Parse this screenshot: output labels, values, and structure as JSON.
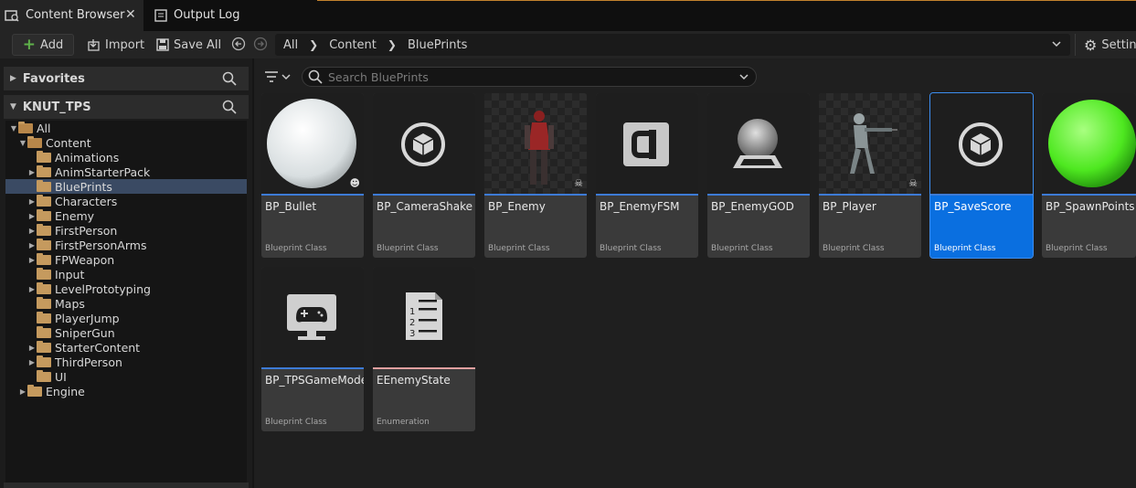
{
  "tabs": [
    {
      "label": "Content Browser",
      "active": true,
      "icon": "content-browser-icon"
    },
    {
      "label": "Output Log",
      "active": false,
      "icon": "output-log-icon"
    }
  ],
  "toolbar": {
    "add_label": "Add",
    "import_label": "Import",
    "save_all_label": "Save All",
    "settings_label": "Settin"
  },
  "breadcrumb": [
    "All",
    "Content",
    "BluePrints"
  ],
  "left": {
    "favorites_label": "Favorites",
    "project_label": "KNUT_TPS",
    "tree": [
      {
        "label": "All",
        "level": 0,
        "caret": "open"
      },
      {
        "label": "Content",
        "level": 1,
        "caret": "open"
      },
      {
        "label": "Animations",
        "level": 2,
        "caret": ""
      },
      {
        "label": "AnimStarterPack",
        "level": 2,
        "caret": "closed"
      },
      {
        "label": "BluePrints",
        "level": 2,
        "caret": "",
        "selected": true
      },
      {
        "label": "Characters",
        "level": 2,
        "caret": "closed"
      },
      {
        "label": "Enemy",
        "level": 2,
        "caret": "closed"
      },
      {
        "label": "FirstPerson",
        "level": 2,
        "caret": "closed"
      },
      {
        "label": "FirstPersonArms",
        "level": 2,
        "caret": "closed"
      },
      {
        "label": "FPWeapon",
        "level": 2,
        "caret": "closed"
      },
      {
        "label": "Input",
        "level": 2,
        "caret": ""
      },
      {
        "label": "LevelPrototyping",
        "level": 2,
        "caret": "closed"
      },
      {
        "label": "Maps",
        "level": 2,
        "caret": ""
      },
      {
        "label": "PlayerJump",
        "level": 2,
        "caret": ""
      },
      {
        "label": "SniperGun",
        "level": 2,
        "caret": ""
      },
      {
        "label": "StarterContent",
        "level": 2,
        "caret": "closed"
      },
      {
        "label": "ThirdPerson",
        "level": 2,
        "caret": "closed"
      },
      {
        "label": "UI",
        "level": 2,
        "caret": ""
      },
      {
        "label": "Engine",
        "level": 1,
        "caret": "closed"
      }
    ]
  },
  "search": {
    "placeholder": "Search BluePrints"
  },
  "assets": [
    {
      "name": "BP_Bullet",
      "type": "Blueprint Class",
      "thumb": "white-sphere",
      "accent": "#3d7bd6"
    },
    {
      "name": "BP_CameraShake",
      "type": "Blueprint Class",
      "thumb": "cube-icon",
      "accent": "#3d7bd6"
    },
    {
      "name": "BP_Enemy",
      "type": "Blueprint Class",
      "thumb": "enemy-character",
      "accent": "#3d7bd6"
    },
    {
      "name": "BP_EnemyFSM",
      "type": "Blueprint Class",
      "thumb": "component-icon",
      "accent": "#3d7bd6"
    },
    {
      "name": "BP_EnemyGOD",
      "type": "Blueprint Class",
      "thumb": "grey-sphere-on-base",
      "accent": "#3d7bd6"
    },
    {
      "name": "BP_Player",
      "type": "Blueprint Class",
      "thumb": "player-character",
      "accent": "#3d7bd6"
    },
    {
      "name": "BP_SaveScore",
      "type": "Blueprint Class",
      "thumb": "cube-icon",
      "accent": "#3d7bd6",
      "selected": true
    },
    {
      "name": "BP_SpawnPoints",
      "type": "Blueprint Class",
      "thumb": "green-sphere",
      "accent": "#3d7bd6"
    },
    {
      "name": "BP_TPSGameMode",
      "type": "Blueprint Class",
      "thumb": "gamepad-monitor-icon",
      "accent": "#3d7bd6"
    },
    {
      "name": "EEnemyState",
      "type": "Enumeration",
      "thumb": "enum-list-icon",
      "accent": "#e0a0a0"
    }
  ],
  "colors": {
    "selection": "#0a6fe0",
    "accent_orange": "#c3822d",
    "add_plus": "#5fb14a"
  }
}
